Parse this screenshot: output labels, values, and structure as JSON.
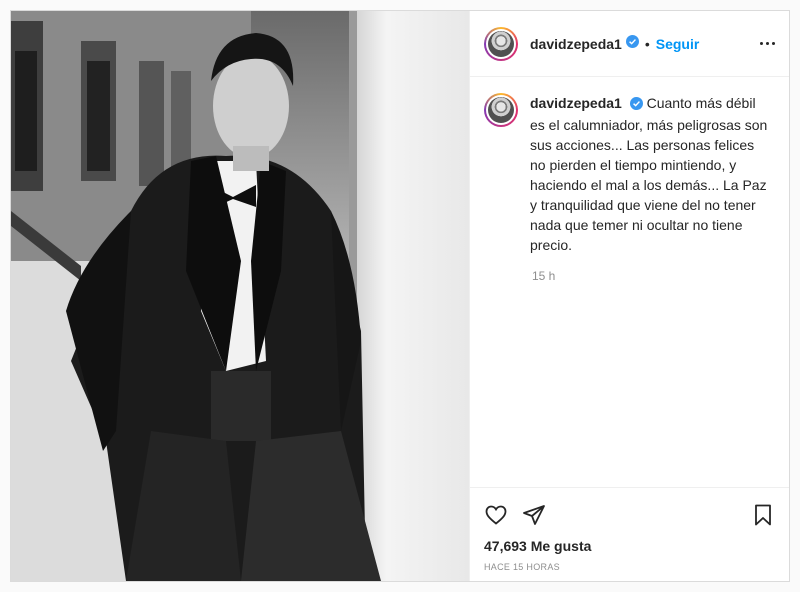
{
  "post": {
    "username": "davidzepeda1",
    "follow_label": "Seguir",
    "separator": "•",
    "caption": "Cuanto más débil es el calumniador, más peligrosas son sus acciones... Las personas felices no pierden el tiempo mintiendo, y haciendo el mal a los demás... La Paz y tranquilidad que viene del no tener nada que temer ni ocultar no tiene precio.",
    "caption_age": "15 h",
    "likes": "47,693 Me gusta",
    "timestamp": "HACE 15 HORAS"
  },
  "colors": {
    "accent": "#0095f6",
    "verified": "#3897f0",
    "muted": "#8e8e8e"
  },
  "icons": {
    "verified": "verified-badge-icon",
    "more": "more-options-icon",
    "like": "heart-icon",
    "share": "paper-plane-icon",
    "save": "bookmark-icon"
  }
}
